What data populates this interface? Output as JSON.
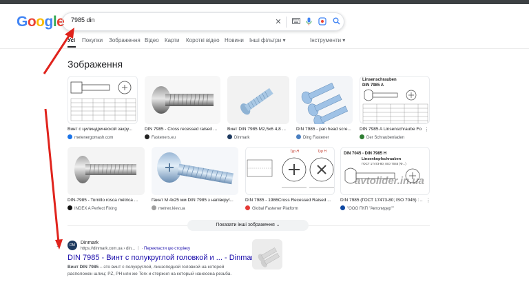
{
  "logo": {
    "text": "Google"
  },
  "search": {
    "value": "7985 din"
  },
  "tabs": [
    "Усі",
    "Покупки",
    "Зображення",
    "Відео",
    "Карти",
    "Короткі відео",
    "Новини",
    "Інші фільтри"
  ],
  "tools_label": "Інструменти",
  "images_section": {
    "title": "Зображення",
    "row1": [
      {
        "caption": "Винт с цилиндрической закру...",
        "source": "metenergomash.com"
      },
      {
        "caption": "DIN 7985 - Cross recessed raised ...",
        "source": "Fasteners.eu"
      },
      {
        "caption": "Винт DIN 7985 M2,5x6 4,8 ...",
        "source": "Dinmark"
      },
      {
        "caption": "DIN 7985 - pan head scre...",
        "source": "Ding Fastener"
      },
      {
        "caption": "DIN 7985 A Linsenschraube Fo...",
        "source": "Der Schraubenladen"
      }
    ],
    "row2": [
      {
        "caption": "DIN-7985 - Tornillo rosca métrica ...",
        "source": "INDEX A Perfect Fixing"
      },
      {
        "caption": "Гвинт М 4х25 мм DIN 7985 з напівкруг...",
        "source": "metrex.kiev.ua"
      },
      {
        "caption": "DIN 7985 - 1986Cross Recessed Raised ...",
        "source": "Global Fastener Platform"
      },
      {
        "caption": "DIN 7985 (ГОСТ 17473-80; ISO 7045) : ...",
        "source": "\"ООО ПКП \"Автолидер\"\""
      }
    ],
    "thumb_texts": {
      "linsen": "Linsenschrauben",
      "din7985a": "DIN 7985 A",
      "typH1": "Typ H",
      "typH2": "Typ H",
      "din7985h": "DIN 7045 - DIN 7985 H",
      "linsen2": "Linsenkopfschrauben",
      "gost": "ГОСТ 17473-80; ISO 7045 (Ф...)",
      "watermark": "avtolider.in.ua"
    },
    "more_button": "Показати інші зображення"
  },
  "result": {
    "number": "1",
    "favicon_text": "DM",
    "site": "Dinmark",
    "url": "https://dinmark.com.ua › din...",
    "translate": "Перекласти цю сторінку",
    "title": "DIN 7985 - Винт с полукруглой головкой и ... - Dinmark",
    "snippet_bold": "Винт DIN 7985",
    "snippet_rest": " – это винт с полукруглой, линзоподной головкой на которой расположен шлиц: PZ, PH или же Torx и стержня на который нанесена резьба."
  },
  "colors": {
    "link": "#1a0dab",
    "arrow": "#e0231c"
  }
}
